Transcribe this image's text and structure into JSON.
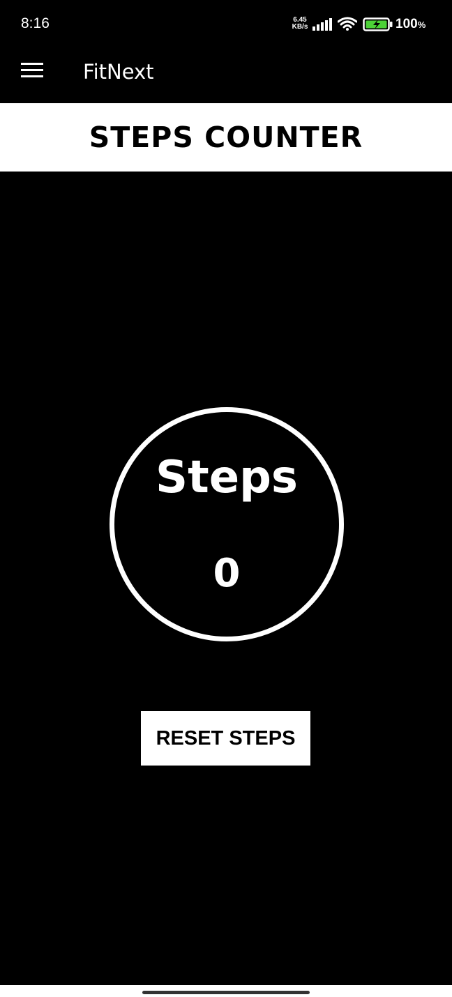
{
  "status_bar": {
    "time": "8:16",
    "net_speed_value": "6.45",
    "net_speed_unit": "KB/s",
    "battery_value": "100",
    "battery_unit": "%",
    "icons": [
      "signal-icon",
      "wifi-icon",
      "battery-charging-icon"
    ],
    "battery_fill_color": "#4cd137"
  },
  "app_bar": {
    "menu_icon": "hamburger-menu-icon",
    "title": "FitNext"
  },
  "header": {
    "title": "STEPS COUNTER"
  },
  "counter": {
    "label": "Steps",
    "value": "0"
  },
  "actions": {
    "reset_label": "RESET STEPS"
  },
  "colors": {
    "background": "#000000",
    "foreground": "#ffffff"
  }
}
